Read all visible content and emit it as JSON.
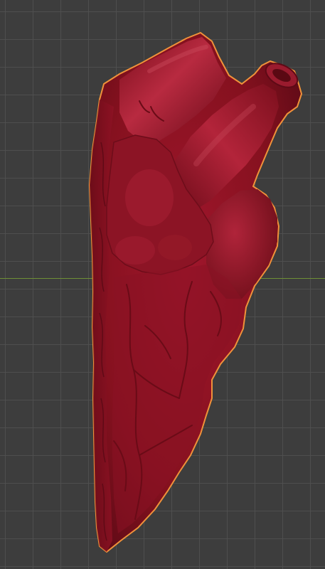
{
  "viewport": {
    "background_color": "#3d3d3d",
    "grid_color": "#505050",
    "x_axis_color": "#6e8f36",
    "selection_outline_color": "#f0923a",
    "object": {
      "type": "anatomical heart mesh",
      "material_color": "#8e1224",
      "selected": true
    }
  }
}
